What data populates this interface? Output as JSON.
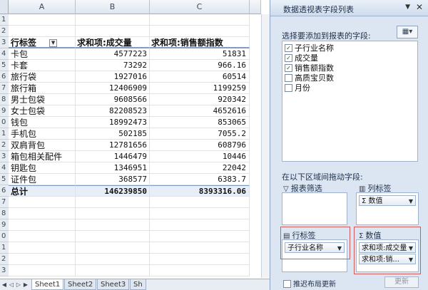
{
  "sheet": {
    "columns": [
      "A",
      "B",
      "C"
    ],
    "header": {
      "row_label": "行标签",
      "col_b": "求和项:成交量",
      "col_c": "求和项:销售额指数"
    },
    "row_numbers": [
      "1",
      "2",
      "3",
      "4",
      "5",
      "6",
      "7",
      "8",
      "9",
      "0",
      "1",
      "2",
      "3",
      "4",
      "5",
      "6",
      "7",
      "8",
      "9",
      "0",
      "1",
      "2",
      "3",
      "4",
      "5"
    ],
    "rows": [
      {
        "name": "卡包",
        "volume": "4577223",
        "index": "51831"
      },
      {
        "name": "卡套",
        "volume": "73292",
        "index": "966.16"
      },
      {
        "name": "旅行袋",
        "volume": "1927016",
        "index": "60514"
      },
      {
        "name": "旅行箱",
        "volume": "12406909",
        "index": "1199259"
      },
      {
        "name": "男士包袋",
        "volume": "9608566",
        "index": "920342"
      },
      {
        "name": "女士包袋",
        "volume": "82208523",
        "index": "4652616"
      },
      {
        "name": "钱包",
        "volume": "18992473",
        "index": "853065"
      },
      {
        "name": "手机包",
        "volume": "502185",
        "index": "7055.2"
      },
      {
        "name": "双肩背包",
        "volume": "12781656",
        "index": "608796"
      },
      {
        "name": "箱包相关配件",
        "volume": "1446479",
        "index": "10446"
      },
      {
        "name": "钥匙包",
        "volume": "1346951",
        "index": "22042"
      },
      {
        "name": "证件包",
        "volume": "368577",
        "index": "6383.7"
      }
    ],
    "total": {
      "name": "总计",
      "volume": "146239850",
      "index": "8393316.06"
    },
    "tabs": [
      "Sheet1",
      "Sheet2",
      "Sheet3",
      "Sh"
    ]
  },
  "pane": {
    "title": "数据透视表字段列表",
    "choose_label": "选择要添加到报表的字段:",
    "fields": [
      {
        "label": "子行业名称",
        "checked": true
      },
      {
        "label": "成交量",
        "checked": true
      },
      {
        "label": "销售额指数",
        "checked": true
      },
      {
        "label": "高质宝贝数",
        "checked": false
      },
      {
        "label": "月份",
        "checked": false
      }
    ],
    "drag_label": "在以下区域间拖动字段:",
    "zones": {
      "filter_label": "报表筛选",
      "column_label": "列标签",
      "row_label": "行标签",
      "values_label": "数值",
      "column_items": [
        "数值"
      ],
      "row_items": [
        "子行业名称"
      ],
      "values_items": [
        "求和项:成交量",
        "求和项:销..."
      ]
    },
    "defer_label": "推迟布局更新",
    "update_label": "更新"
  },
  "colors": {
    "accent_red": "#d45b5b",
    "pane_bg": "#dce6f2"
  }
}
